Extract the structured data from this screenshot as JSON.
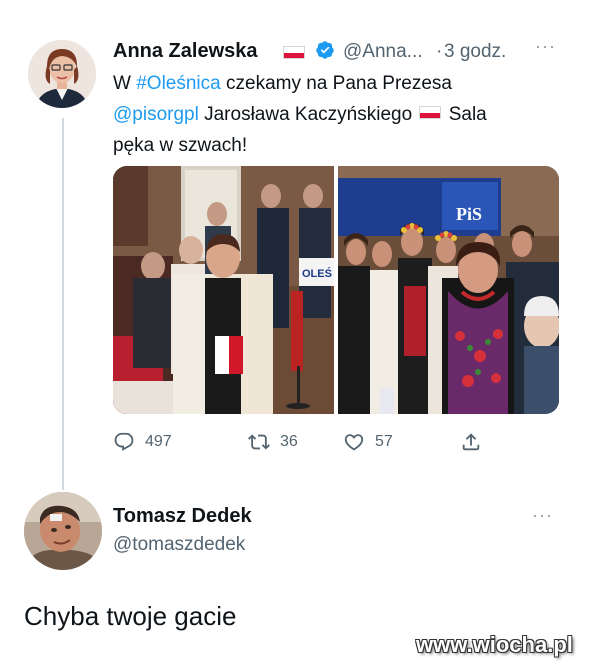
{
  "tweet": {
    "author_name": "Anna Zalewska",
    "handle": "@Anna...",
    "separator": "·",
    "time": "3 godz.",
    "text_parts": {
      "p1": "W ",
      "hashtag": "#Oleśnica",
      "p2": " czekamy na Pana Prezesa",
      "mention": "@pisorgpl",
      "p3": " Jarosława Kaczyńskiego ",
      "p4": " Sala",
      "p5": "pęka w szwach!"
    },
    "photo_sign": "OLEŚ",
    "photo_logo": "PiS",
    "stats": {
      "replies": "497",
      "retweets": "36",
      "likes": "57"
    }
  },
  "reply": {
    "author_name": "Tomasz Dedek",
    "handle": "@tomaszdedek",
    "text": "Chyba twoje gacie"
  },
  "more_label": "···",
  "watermark": "www.wiocha.pl",
  "colors": {
    "link": "#1d9bf0",
    "verified": "#1d9bf0",
    "secondary": "#536471",
    "flag_red": "#dc143c"
  },
  "icons": [
    "reply-icon",
    "retweet-icon",
    "like-icon",
    "share-icon",
    "verified-badge-icon",
    "flag-icon",
    "more-icon"
  ]
}
